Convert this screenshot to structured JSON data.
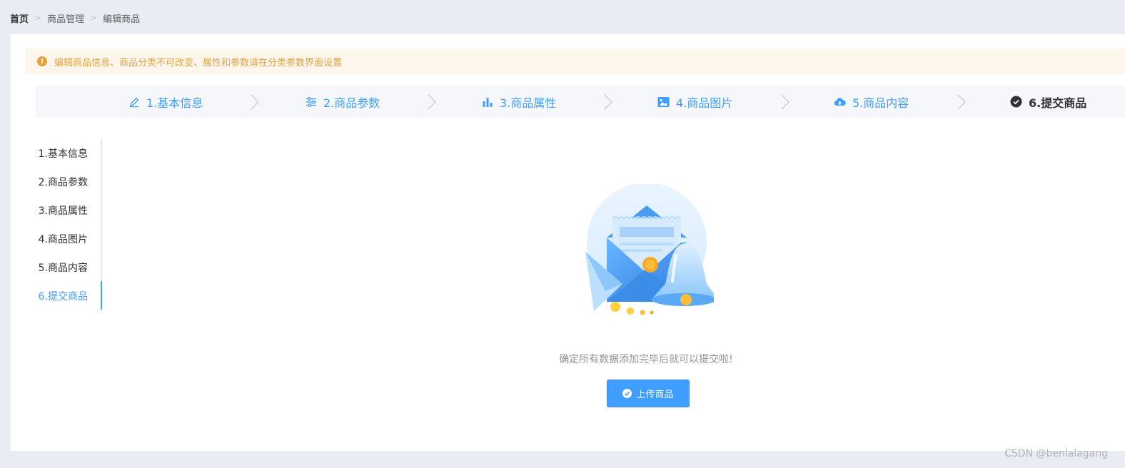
{
  "breadcrumb": [
    "首页",
    "商品管理",
    "编辑商品"
  ],
  "alert": {
    "text": "编辑商品信息、商品分类不可改变、属性和参数请在分类参数界面设置",
    "color": "#e6a23c"
  },
  "steps": [
    {
      "label": "1.基本信息",
      "icon": "pencil-icon"
    },
    {
      "label": "2.商品参数",
      "icon": "sliders-icon"
    },
    {
      "label": "3.商品属性",
      "icon": "bar-chart-icon"
    },
    {
      "label": "4.商品图片",
      "icon": "image-icon"
    },
    {
      "label": "5.商品内容",
      "icon": "cloud-upload-icon"
    },
    {
      "label": "6.提交商品",
      "icon": "check-circle-icon"
    }
  ],
  "tabs": [
    "1.基本信息",
    "2.商品参数",
    "3.商品属性",
    "4.商品图片",
    "5.商品内容",
    "6.提交商品"
  ],
  "active_tab": "6.提交商品",
  "confirm_text": "确定所有数据添加完毕后就可以提交啦!",
  "upload_button": "上传商品",
  "watermark": "CSDN @benlalagang",
  "colors": {
    "primary": "#409eff",
    "warning": "#e6a23c",
    "background": "#e9ecf3"
  }
}
